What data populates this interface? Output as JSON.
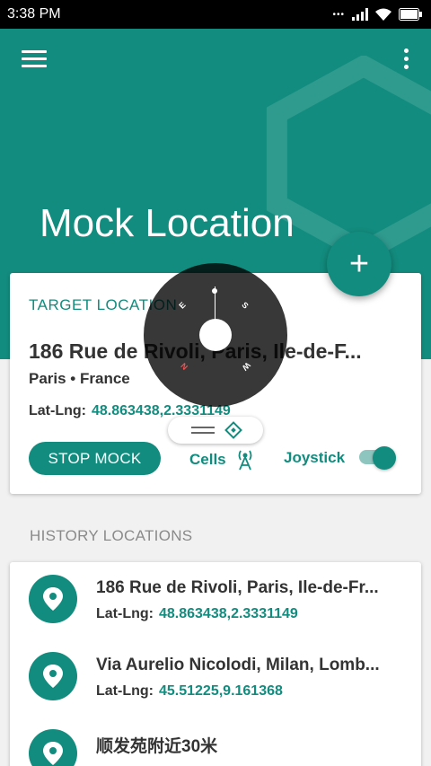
{
  "status_bar": {
    "time": "3:38 PM"
  },
  "header": {
    "title": "Mock Location"
  },
  "target": {
    "label": "TARGET LOCATION",
    "address": "186 Rue de Rivoli, Paris, Ile-de-F...",
    "city_country": "Paris • France",
    "latlng_label": "Lat-Lng:",
    "latlng_value": "48.863438,2.3331149",
    "stop_label": "STOP MOCK",
    "cells_label": "Cells",
    "joystick_label": "Joystick",
    "joystick_enabled": true
  },
  "history": {
    "header": "HISTORY LOCATIONS",
    "latlng_label": "Lat-Lng:",
    "items": [
      {
        "address": "186 Rue de Rivoli, Paris, Ile-de-Fr...",
        "latlng": "48.863438,2.3331149"
      },
      {
        "address": "Via Aurelio Nicolodi, Milan, Lomb...",
        "latlng": "45.51225,9.161368"
      },
      {
        "address": "顺发苑附近30米",
        "latlng": ""
      }
    ]
  },
  "joystick_overlay": {
    "directions": [
      "E",
      "S",
      "N",
      "W"
    ]
  },
  "colors": {
    "primary": "#128c7e",
    "background": "#f1f1f1",
    "text": "#333333",
    "muted": "#8a8a8a"
  },
  "icons": [
    "menu-icon",
    "more-vert-icon",
    "add-icon",
    "antenna-icon",
    "location-pin-icon",
    "grip-icon",
    "diamond-icon"
  ]
}
